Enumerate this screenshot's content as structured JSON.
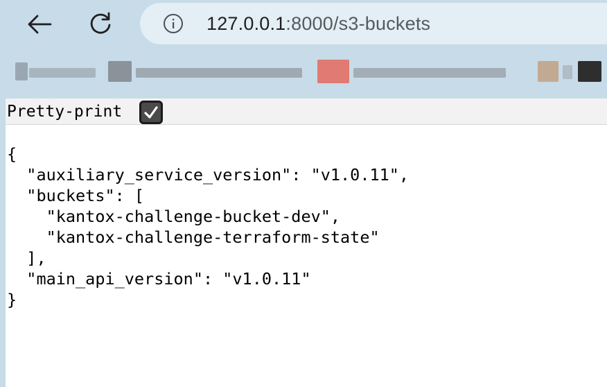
{
  "browser": {
    "url_host": "127.0.0.1",
    "url_path": ":8000/s3-buckets",
    "toolbar_bg": "#c7dbe8",
    "omnibox_bg": "#e3eef5"
  },
  "bookmarks_bar": {
    "note_hidden": true
  },
  "controls": {
    "pretty_print_label": "Pretty-print",
    "pretty_print_checked": true
  },
  "json_view": {
    "lines": [
      "{",
      "  \"auxiliary_service_version\": \"v1.0.11\",",
      "  \"buckets\": [",
      "    \"kantox-challenge-bucket-dev\",",
      "    \"kantox-challenge-terraform-state\"",
      "  ],",
      "  \"main_api_version\": \"v1.0.11\"",
      "}"
    ]
  }
}
